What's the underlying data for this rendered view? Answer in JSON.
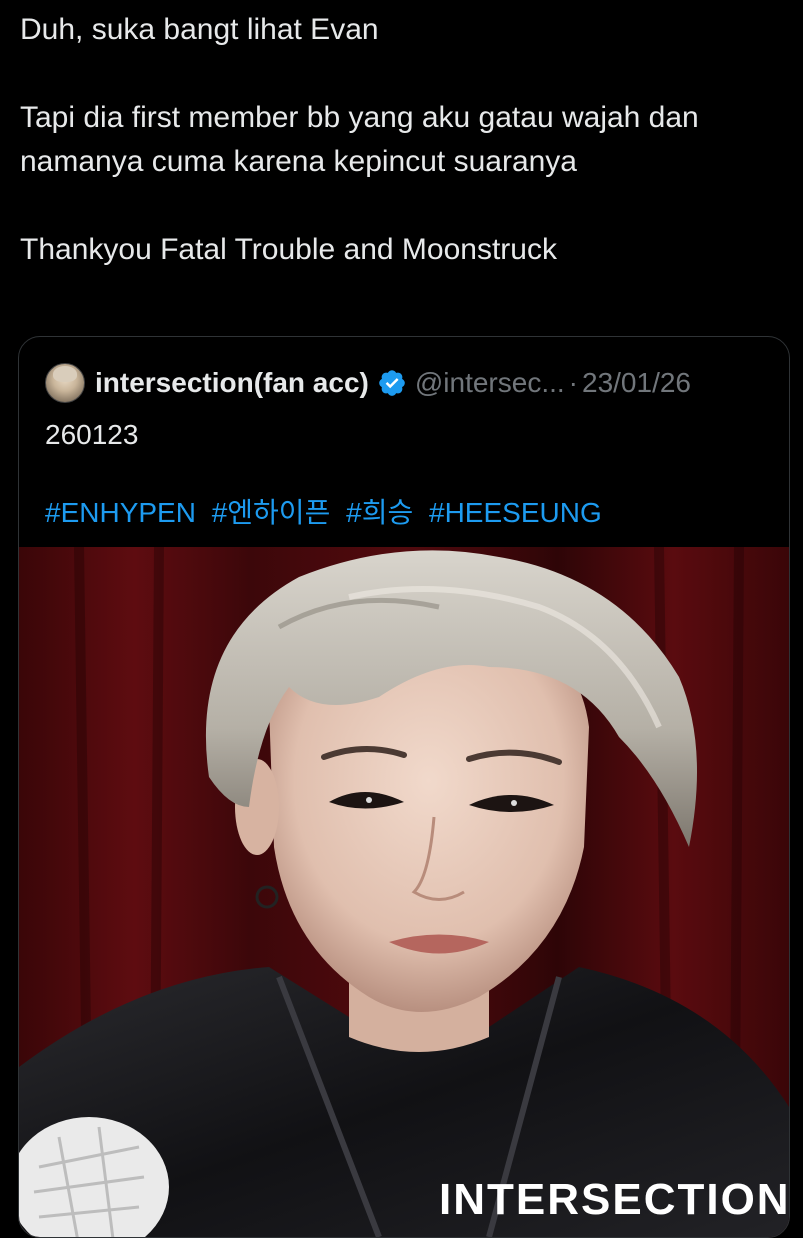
{
  "tweet": {
    "lines": [
      "Duh, suka bangt lihat Evan",
      "Tapi dia first member bb yang aku gatau wajah dan namanya cuma karena kepincut suaranya",
      "Thankyou Fatal Trouble and Moonstruck"
    ]
  },
  "quote": {
    "author_name": "intersection(fan acc)",
    "verified_icon": "verified-badge-icon",
    "handle": "@intersec...",
    "separator": "·",
    "date": "23/01/26",
    "body": "260123",
    "hashtags": [
      "#ENHYPEN",
      "#엔하이픈",
      "#희승",
      "#HEESEUNG"
    ],
    "media": {
      "description_icon": "photo-media",
      "watermark": "INTERSECTION"
    }
  },
  "colors": {
    "background": "#000000",
    "text": "#e7e9ea",
    "secondary_text": "#71767b",
    "link": "#1d9bf0",
    "verified": "#1d9bf0",
    "card_border": "#2f3336"
  }
}
